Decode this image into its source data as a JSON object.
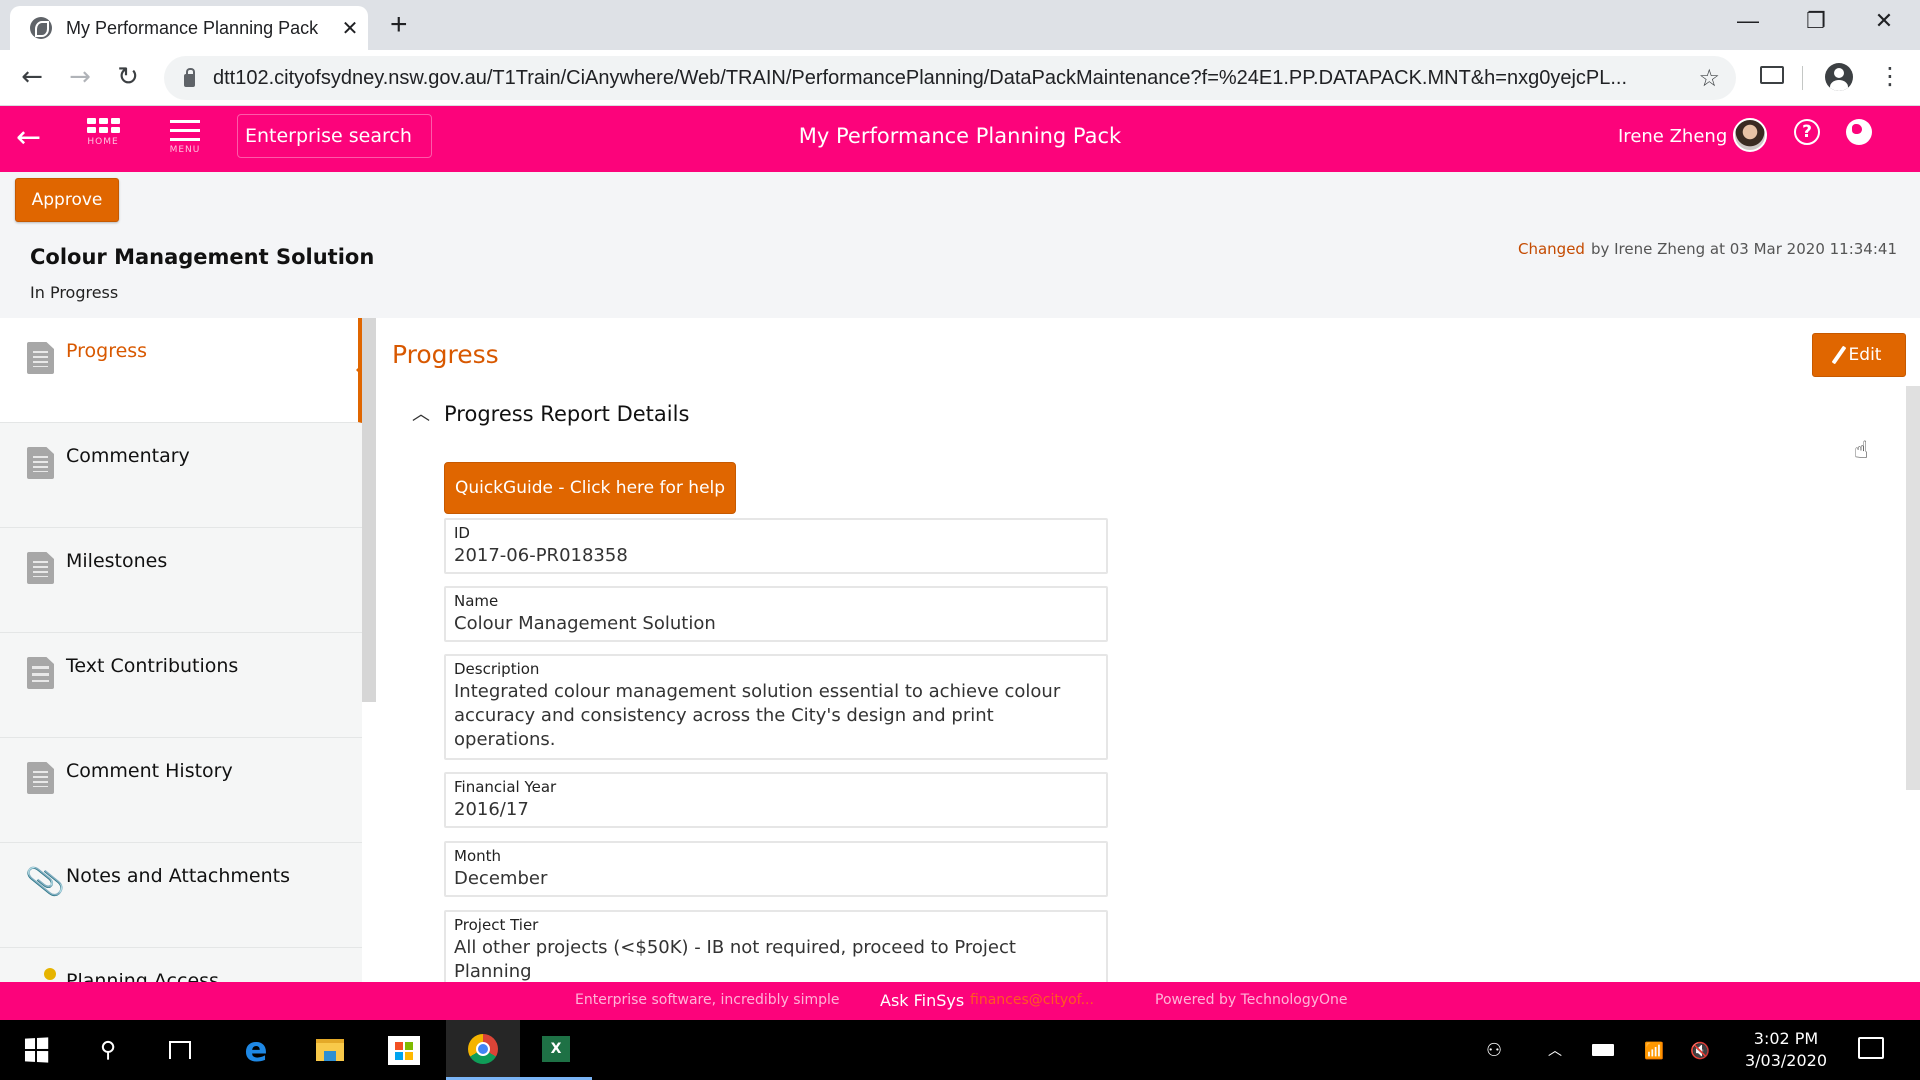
{
  "browser": {
    "tab_title": "My Performance Planning Pack",
    "tab_close": "✕",
    "new_tab": "+",
    "url": "dtt102.cityofsydney.nsw.gov.au/T1Train/CiAnywhere/Web/TRAIN/PerformancePlanning/DataPackMaintenance?f=%24E1.PP.DATAPACK.MNT&h=nxg0yejcPL...",
    "minimize": "—",
    "restore": "❐",
    "close": "✕",
    "back": "←",
    "forward": "→",
    "reload": "↻",
    "bookmark_star": "☆",
    "menu_dots": "⋮"
  },
  "appbar": {
    "back_arrow": "←",
    "home_caption": "HOME",
    "menu_caption": "MENU",
    "search_placeholder": "Enterprise search",
    "title": "My Performance Planning Pack",
    "user_name": "Irene Zheng",
    "help": "?"
  },
  "record": {
    "approve_label": "Approve",
    "title": "Colour Management Solution",
    "status": "In Progress",
    "changed_label": "Changed",
    "changed_by": "by Irene Zheng  at 03 Mar 2020 11:34:41"
  },
  "sidebar": {
    "items": [
      {
        "label": "Progress",
        "icon": "document-icon",
        "active": true
      },
      {
        "label": "Commentary",
        "icon": "document-icon"
      },
      {
        "label": "Milestones",
        "icon": "document-icon"
      },
      {
        "label": "Text Contributions",
        "icon": "checklist-icon"
      },
      {
        "label": "Comment History",
        "icon": "document-icon"
      },
      {
        "label": "Notes and Attachments",
        "icon": "paperclip-icon"
      },
      {
        "label": "Planning Access",
        "icon": "status-dot-icon"
      }
    ]
  },
  "main": {
    "section_title": "Progress",
    "edit_label": "Edit",
    "collapse_glyph": "︿",
    "group_title": "Progress Report Details",
    "quickguide_label": "QuickGuide - Click here for help",
    "fields": [
      {
        "label": "ID",
        "value": "2017-06-PR018358"
      },
      {
        "label": "Name",
        "value": "Colour Management Solution"
      },
      {
        "label": "Description",
        "value": "Integrated colour management solution essential to achieve colour accuracy and consistency across the City's design and print operations."
      },
      {
        "label": "Financial Year",
        "value": "2016/17"
      },
      {
        "label": "Month",
        "value": "December"
      },
      {
        "label": "Project Tier",
        "value": "All other projects (<$50K) - IB not required, proceed to Project Planning"
      }
    ]
  },
  "footer": {
    "tagline": "Enterprise software, incredibly simple",
    "ask": "Ask FinSys",
    "email": "finances@cityof...",
    "powered": "Powered by TechnologyOne"
  },
  "taskbar": {
    "time": "3:02 PM",
    "date": "3/03/2020",
    "apps": [
      "start",
      "search",
      "task-view",
      "edge",
      "file-explorer",
      "store",
      "chrome",
      "excel"
    ]
  },
  "colors": {
    "brand_pink": "#fc037b",
    "accent_orange": "#e06600"
  }
}
